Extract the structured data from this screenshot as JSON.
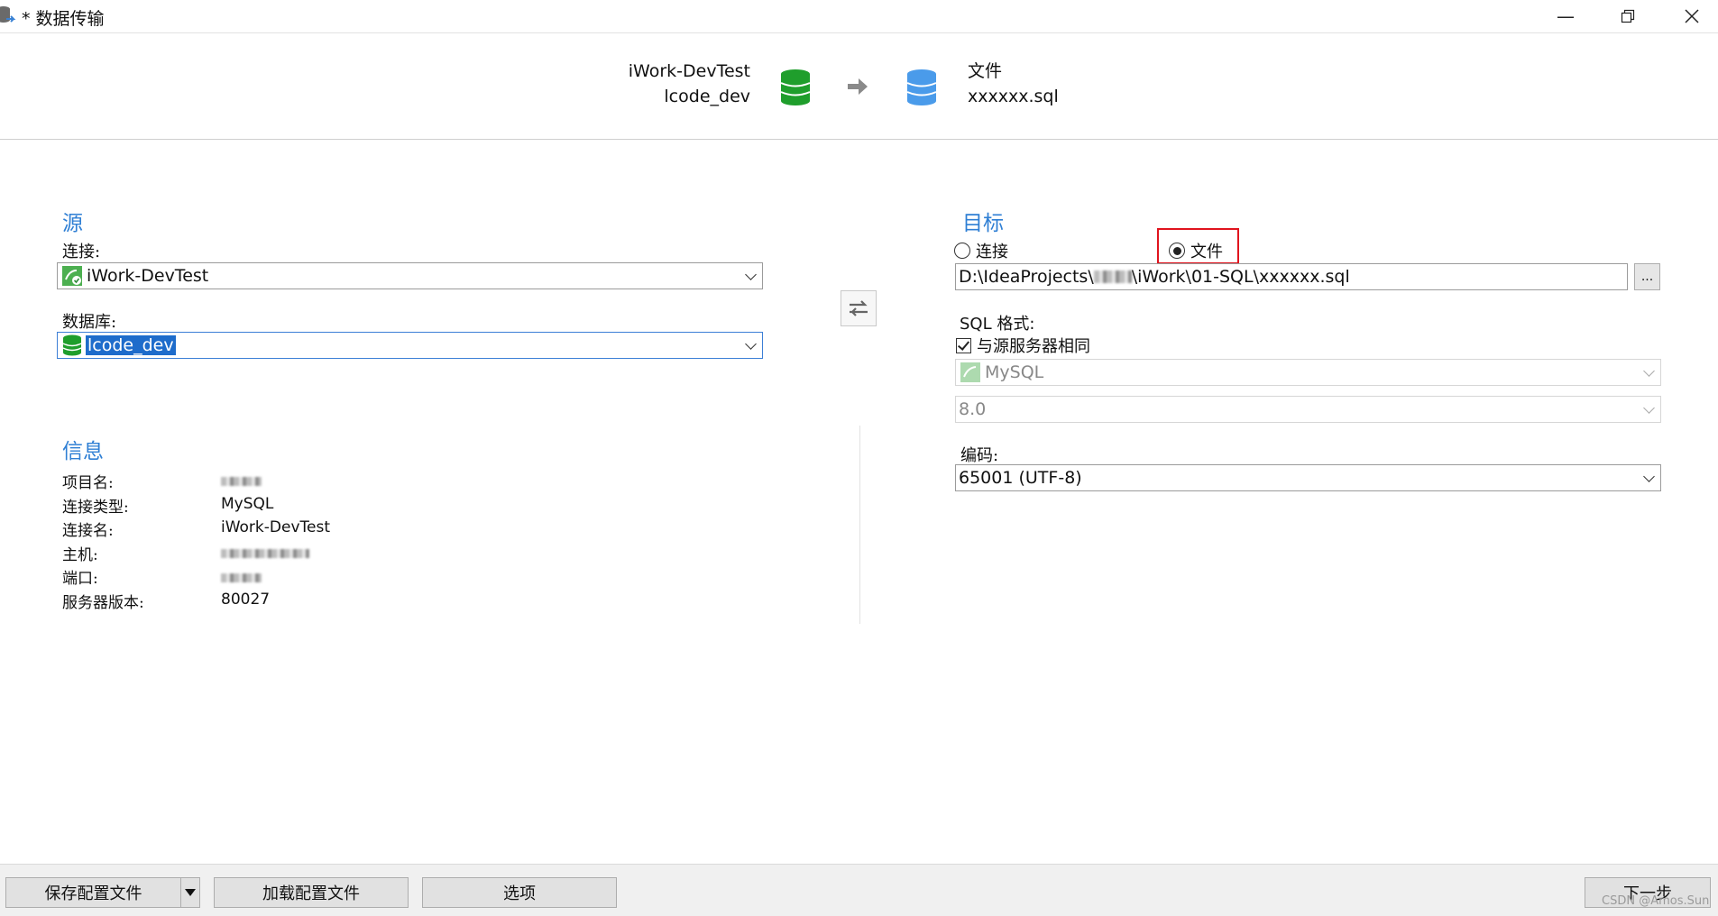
{
  "window": {
    "title": "* 数据传输"
  },
  "header": {
    "source_connection": "iWork-DevTest",
    "source_database": "lcode_dev",
    "target_type": "文件",
    "target_file": "xxxxxx.sql"
  },
  "source": {
    "section_title": "源",
    "connection_label": "连接:",
    "connection_value": "iWork-DevTest",
    "database_label": "数据库:",
    "database_value": "lcode_dev"
  },
  "info": {
    "section_title": "信息",
    "rows": [
      {
        "label": "项目名:",
        "value": ""
      },
      {
        "label": "连接类型:",
        "value": "MySQL"
      },
      {
        "label": "连接名:",
        "value": "iWork-DevTest"
      },
      {
        "label": "主机:",
        "value": ""
      },
      {
        "label": "端口:",
        "value": ""
      },
      {
        "label": "服务器版本:",
        "value": "80027"
      }
    ]
  },
  "target": {
    "section_title": "目标",
    "radio_connection": "连接",
    "radio_file": "文件",
    "selected": "文件",
    "file_path_prefix": "D:\\IdeaProjects\\",
    "file_path_suffix": "\\iWork\\01-SQL\\xxxxxx.sql",
    "browse_label": "...",
    "sql_format_label": "SQL 格式:",
    "same_as_source_label": "与源服务器相同",
    "same_as_source_checked": true,
    "server_type_value": "MySQL",
    "server_version_value": "8.0",
    "encoding_label": "编码:",
    "encoding_value": "65001 (UTF-8)"
  },
  "footer": {
    "save_profile": "保存配置文件",
    "load_profile": "加载配置文件",
    "options": "选项",
    "next": "下一步"
  },
  "watermark": "CSDN @Amos.Sun",
  "colors": {
    "accent": "#2f7fd4",
    "db_green": "#1f9e2c",
    "db_blue": "#4a9bea",
    "highlight_red": "#e0141e"
  }
}
